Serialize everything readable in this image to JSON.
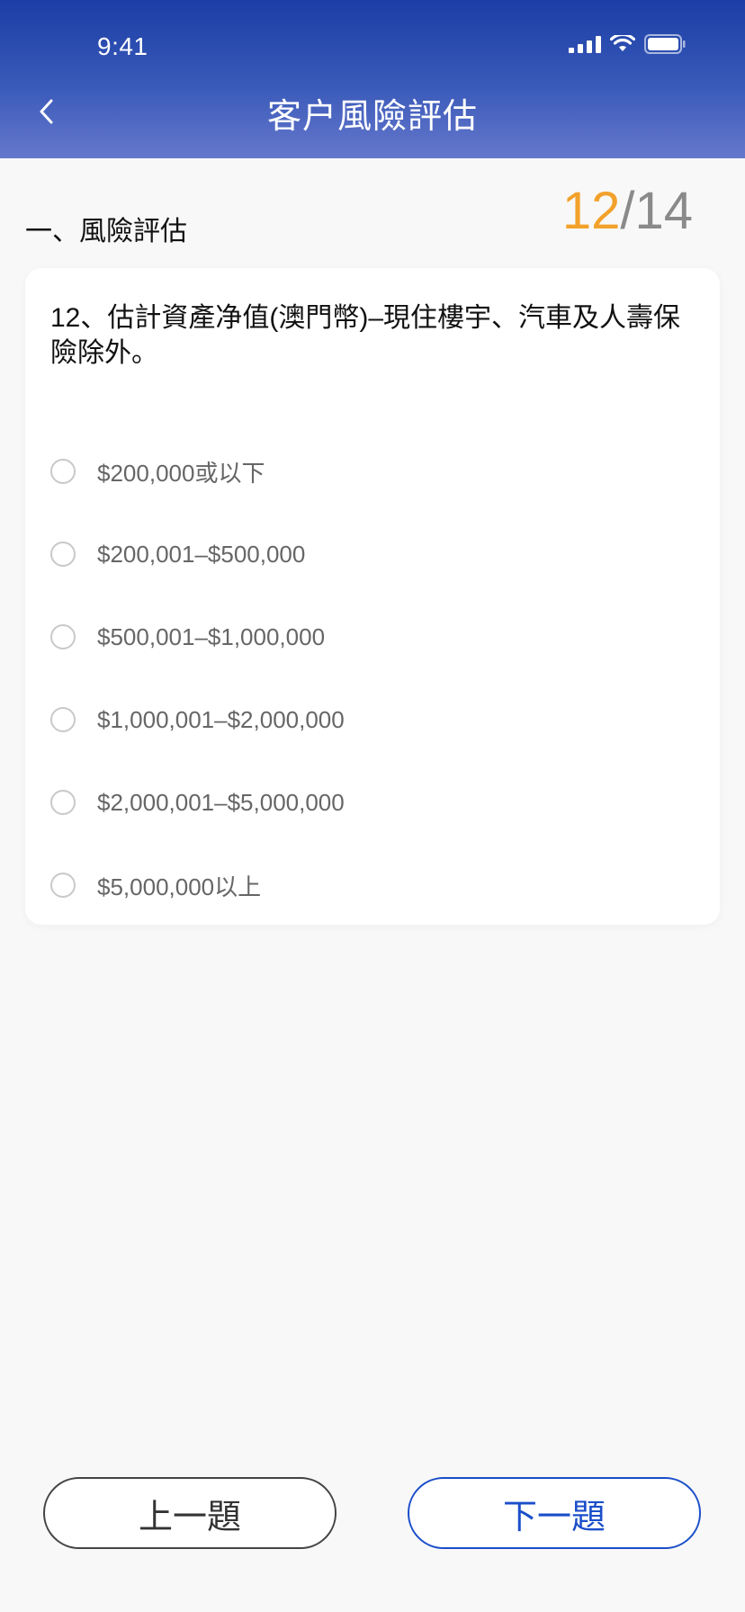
{
  "status_bar": {
    "time": "9:41"
  },
  "header": {
    "title": "客户風險評估",
    "back_icon": "chevron-left-icon"
  },
  "section": {
    "title": "一、風險評估"
  },
  "progress": {
    "current": "12",
    "separator": "/",
    "total": "14"
  },
  "question": {
    "text": "12、估計資產净值(澳門幣)–現住樓宇、汽車及人壽保險除外。",
    "options": [
      {
        "label": "$200,000或以下"
      },
      {
        "label": "$200,001–$500,000"
      },
      {
        "label": "$500,001–$1,000,000"
      },
      {
        "label": "$1,000,001–$2,000,000"
      },
      {
        "label": "$2,000,001–$5,000,000"
      },
      {
        "label": "$5,000,000以上"
      }
    ]
  },
  "footer": {
    "prev_label": "上一題",
    "next_label": "下一題"
  },
  "colors": {
    "header_gradient_top": "#1b3ea6",
    "header_gradient_bottom": "#6678cc",
    "accent_orange": "#f2a12a",
    "primary_blue": "#1b4ec9"
  }
}
